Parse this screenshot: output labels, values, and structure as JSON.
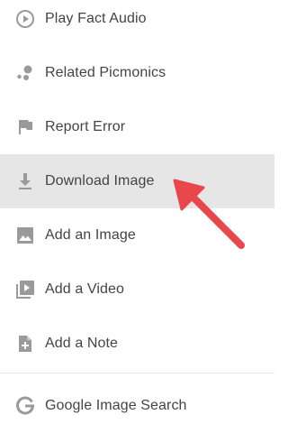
{
  "menu": {
    "items": [
      {
        "label": "Play Fact Audio",
        "icon": "play-circle-icon"
      },
      {
        "label": "Related Picmonics",
        "icon": "bubbles-icon"
      },
      {
        "label": "Report Error",
        "icon": "flag-icon"
      },
      {
        "label": "Download Image",
        "icon": "download-icon",
        "highlighted": true
      },
      {
        "label": "Add an Image",
        "icon": "image-icon"
      },
      {
        "label": "Add a Video",
        "icon": "video-library-icon"
      },
      {
        "label": "Add a Note",
        "icon": "note-add-icon"
      },
      {
        "label": "Google Image Search",
        "icon": "google-g-icon"
      }
    ]
  },
  "colors": {
    "text": "#444444",
    "icon": "#9a9a9a",
    "highlight": "#e6e6e6",
    "divider": "#e4e4e4",
    "annotation_arrow": "#e8474b"
  },
  "annotation": {
    "type": "arrow",
    "points_to": "Download Image"
  }
}
